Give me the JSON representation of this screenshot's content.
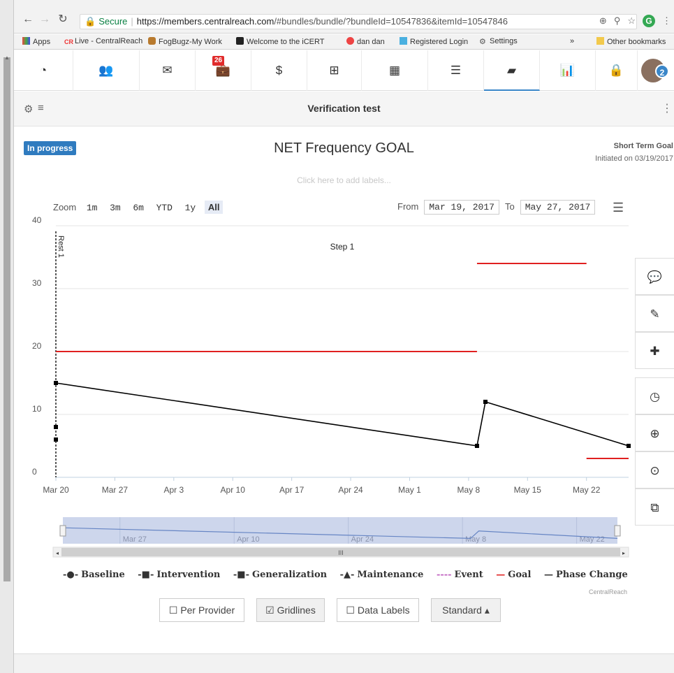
{
  "browser": {
    "url_secure": "Secure",
    "url_host": "https://members.centralreach.com",
    "url_rest": "/#bundles/bundle/?bundleId=10547836&itemId=10547846",
    "bookmarks": [
      "Apps",
      "Live - CentralReach",
      "FogBugz-My Work",
      "Welcome to the iCERT",
      "dan dan",
      "Registered Login",
      "Settings",
      "»",
      "Other bookmarks"
    ]
  },
  "appnav": {
    "mail_badge": "26",
    "dollar": "$",
    "avatar_badge": "2"
  },
  "header": {
    "title": "Verification test"
  },
  "goal": {
    "status": "In progress",
    "title": "NET Frequency GOAL",
    "type": "Short Term Goal",
    "initiated": "Initiated on 03/19/2017",
    "labels_placeholder": "Click here to add labels..."
  },
  "controls": {
    "zoom_label": "Zoom",
    "zoom_options": [
      "1m",
      "3m",
      "6m",
      "YTD",
      "1y",
      "All"
    ],
    "from_label": "From",
    "from_value": "Mar 19, 2017",
    "to_label": "To",
    "to_value": "May 27, 2017"
  },
  "chart_data": {
    "type": "line",
    "y_ticks": [
      "0",
      "10",
      "20",
      "30",
      "40"
    ],
    "ylim": [
      0,
      40
    ],
    "x_ticks": [
      "Mar 20",
      "Mar 27",
      "Apr 3",
      "Apr 10",
      "Apr 17",
      "Apr 24",
      "May 1",
      "May 8",
      "May 15",
      "May 22"
    ],
    "x_range_days": [
      0,
      68
    ],
    "phase_line": {
      "label": "Rest 1",
      "x": "Mar 20"
    },
    "step_label": "Step 1",
    "intervention_points": [
      {
        "x": "Mar 20",
        "y": 6
      },
      {
        "x": "Mar 20",
        "y": 8
      },
      {
        "x": "Mar 20",
        "y": 15
      },
      {
        "x": "May 9",
        "y": 5
      },
      {
        "x": "May 10",
        "y": 12
      },
      {
        "x": "May 27",
        "y": 5
      }
    ],
    "goal_segments": [
      {
        "x_start": "Mar 20",
        "x_end": "May 9",
        "y": 20
      },
      {
        "x_start": "May 9",
        "x_end": "May 22",
        "y": 34
      },
      {
        "x_start": "May 22",
        "x_end": "May 27",
        "y": 3
      }
    ],
    "grid": true,
    "navigator_ticks": [
      "Mar 27",
      "Apr 10",
      "Apr 24",
      "May 8",
      "May 22"
    ],
    "legend": [
      "Baseline",
      "Intervention",
      "Generalization",
      "Maintenance",
      "Event",
      "Goal",
      "Phase Change"
    ],
    "colors": {
      "intervention": "#000000",
      "goal": "#e02020",
      "navigator_fill": "#cdd6ec",
      "navigator_line": "#6685c4"
    }
  },
  "credit": "CentralReach",
  "buttons": {
    "per_provider": "Per Provider",
    "gridlines": "Gridlines",
    "data_labels": "Data Labels",
    "standard": "Standard"
  }
}
